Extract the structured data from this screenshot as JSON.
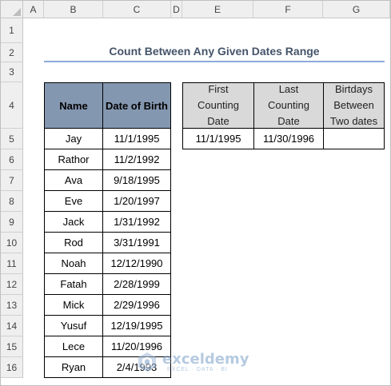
{
  "columns": [
    "A",
    "B",
    "C",
    "D",
    "E",
    "F",
    "G"
  ],
  "rows": [
    "1",
    "2",
    "3",
    "4",
    "5",
    "6",
    "7",
    "8",
    "9",
    "10",
    "11",
    "12",
    "13",
    "14",
    "15",
    "16"
  ],
  "title": "Count Between Any Given Dates Range",
  "table": {
    "headers": {
      "name": "Name",
      "dob": "Date of Birth"
    },
    "records": [
      {
        "name": "Jay",
        "dob": "11/1/1995"
      },
      {
        "name": "Rathor",
        "dob": "11/2/1992"
      },
      {
        "name": "Ava",
        "dob": "9/18/1995"
      },
      {
        "name": "Eve",
        "dob": "1/20/1997"
      },
      {
        "name": "Jack",
        "dob": "1/31/1992"
      },
      {
        "name": "Rod",
        "dob": "3/31/1991"
      },
      {
        "name": "Noah",
        "dob": "12/12/1990"
      },
      {
        "name": "Fatah",
        "dob": "2/28/1999"
      },
      {
        "name": "Mick",
        "dob": "2/29/1996"
      },
      {
        "name": "Yusuf",
        "dob": "12/19/1995"
      },
      {
        "name": "Lece",
        "dob": "11/20/1996"
      },
      {
        "name": "Ryan",
        "dob": "2/4/1993"
      }
    ]
  },
  "summary": {
    "headers": {
      "first": [
        "First",
        "Counting",
        "Date"
      ],
      "last": [
        "Last",
        "Counting",
        "Date"
      ],
      "between": [
        "Birtdays",
        "Between",
        "Two dates"
      ]
    },
    "values": {
      "first": "11/1/1995",
      "last": "11/30/1996",
      "between": ""
    }
  },
  "watermark": {
    "name": "exceldemy",
    "tagline": "EXCEL · DATA · BI"
  },
  "colors": {
    "header_blue": "#8497b0",
    "header_grey": "#d9d9d9",
    "title_text": "#44546a",
    "title_underline": "#8ea9db"
  }
}
